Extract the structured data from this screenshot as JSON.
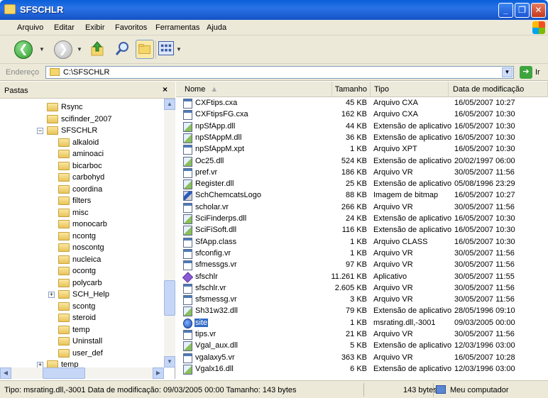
{
  "window": {
    "title": "SFSCHLR"
  },
  "menu": [
    "Arquivo",
    "Editar",
    "Exibir",
    "Favoritos",
    "Ferramentas",
    "Ajuda"
  ],
  "address": {
    "label": "Endereço",
    "value": "C:\\SFSCHLR",
    "go_label": "Ir"
  },
  "folders_pane": {
    "title": "Pastas",
    "close": "×",
    "items": [
      {
        "label": "Rsync",
        "level": 1
      },
      {
        "label": "scifinder_2007",
        "level": 1
      },
      {
        "label": "SFSCHLR",
        "level": 1,
        "expanded": true
      },
      {
        "label": "alkaloid",
        "level": 2
      },
      {
        "label": "aminoaci",
        "level": 2
      },
      {
        "label": "bicarboc",
        "level": 2
      },
      {
        "label": "carbohyd",
        "level": 2
      },
      {
        "label": "coordina",
        "level": 2
      },
      {
        "label": "filters",
        "level": 2
      },
      {
        "label": "misc",
        "level": 2
      },
      {
        "label": "monocarb",
        "level": 2
      },
      {
        "label": "ncontg",
        "level": 2
      },
      {
        "label": "noscontg",
        "level": 2
      },
      {
        "label": "nucleica",
        "level": 2
      },
      {
        "label": "ocontg",
        "level": 2
      },
      {
        "label": "polycarb",
        "level": 2
      },
      {
        "label": "SCH_Help",
        "level": 2,
        "collapsed": true
      },
      {
        "label": "scontg",
        "level": 2
      },
      {
        "label": "steroid",
        "level": 2
      },
      {
        "label": "temp",
        "level": 2
      },
      {
        "label": "Uninstall",
        "level": 2
      },
      {
        "label": "user_def",
        "level": 2
      },
      {
        "label": "temp",
        "level": 1,
        "collapsed": true
      }
    ]
  },
  "columns": {
    "name": "Nome",
    "size": "Tamanho",
    "type": "Tipo",
    "date": "Data de modificação"
  },
  "files": [
    {
      "name": "CXFtips.cxa",
      "size": "45 KB",
      "type": "Arquivo CXA",
      "date": "16/05/2007 10:27",
      "icon": "doc"
    },
    {
      "name": "CXFtipsFG.cxa",
      "size": "162 KB",
      "type": "Arquivo CXA",
      "date": "16/05/2007 10:30",
      "icon": "doc"
    },
    {
      "name": "npSfApp.dll",
      "size": "44 KB",
      "type": "Extensão de aplicativo",
      "date": "16/05/2007 10:30",
      "icon": "dll"
    },
    {
      "name": "npSfAppM.dll",
      "size": "36 KB",
      "type": "Extensão de aplicativo",
      "date": "16/05/2007 10:30",
      "icon": "dll"
    },
    {
      "name": "npSfAppM.xpt",
      "size": "1 KB",
      "type": "Arquivo XPT",
      "date": "16/05/2007 10:30",
      "icon": "doc"
    },
    {
      "name": "Oc25.dll",
      "size": "524 KB",
      "type": "Extensão de aplicativo",
      "date": "20/02/1997 06:00",
      "icon": "dll"
    },
    {
      "name": "pref.vr",
      "size": "186 KB",
      "type": "Arquivo VR",
      "date": "30/05/2007 11:56",
      "icon": "doc"
    },
    {
      "name": "Register.dll",
      "size": "25 KB",
      "type": "Extensão de aplicativo",
      "date": "05/08/1996 23:29",
      "icon": "dll"
    },
    {
      "name": "SchChemcatsLogo",
      "size": "88 KB",
      "type": "Imagem de bitmap",
      "date": "16/05/2007 10:27",
      "icon": "bmp"
    },
    {
      "name": "scholar.vr",
      "size": "266 KB",
      "type": "Arquivo VR",
      "date": "30/05/2007 11:56",
      "icon": "doc"
    },
    {
      "name": "SciFinderps.dll",
      "size": "24 KB",
      "type": "Extensão de aplicativo",
      "date": "16/05/2007 10:30",
      "icon": "dll"
    },
    {
      "name": "SciFiSoft.dll",
      "size": "116 KB",
      "type": "Extensão de aplicativo",
      "date": "16/05/2007 10:30",
      "icon": "dll"
    },
    {
      "name": "SfApp.class",
      "size": "1 KB",
      "type": "Arquivo CLASS",
      "date": "16/05/2007 10:30",
      "icon": "doc"
    },
    {
      "name": "sfconfig.vr",
      "size": "1 KB",
      "type": "Arquivo VR",
      "date": "30/05/2007 11:56",
      "icon": "doc"
    },
    {
      "name": "sfmessgs.vr",
      "size": "97 KB",
      "type": "Arquivo VR",
      "date": "30/05/2007 11:56",
      "icon": "doc"
    },
    {
      "name": "sfschlr",
      "size": "11.261 KB",
      "type": "Aplicativo",
      "date": "30/05/2007 11:55",
      "icon": "app"
    },
    {
      "name": "sfschlr.vr",
      "size": "2.605 KB",
      "type": "Arquivo VR",
      "date": "30/05/2007 11:56",
      "icon": "doc"
    },
    {
      "name": "sfsmessg.vr",
      "size": "3 KB",
      "type": "Arquivo VR",
      "date": "30/05/2007 11:56",
      "icon": "doc"
    },
    {
      "name": "Sh31w32.dll",
      "size": "79 KB",
      "type": "Extensão de aplicativo",
      "date": "28/05/1996 09:10",
      "icon": "dll"
    },
    {
      "name": "site",
      "size": "1 KB",
      "type": "msrating.dll,-3001",
      "date": "09/03/2005 00:00",
      "icon": "url",
      "selected": true
    },
    {
      "name": "tips.vr",
      "size": "21 KB",
      "type": "Arquivo VR",
      "date": "30/05/2007 11:56",
      "icon": "doc"
    },
    {
      "name": "Vgal_aux.dll",
      "size": "5 KB",
      "type": "Extensão de aplicativo",
      "date": "12/03/1996 03:00",
      "icon": "dll"
    },
    {
      "name": "vgalaxy5.vr",
      "size": "363 KB",
      "type": "Arquivo VR",
      "date": "16/05/2007 10:28",
      "icon": "doc"
    },
    {
      "name": "Vgalx16.dll",
      "size": "6 KB",
      "type": "Extensão de aplicativo",
      "date": "12/03/1996 03:00",
      "icon": "dll"
    }
  ],
  "status": {
    "text": "Tipo: msrating.dll,-3001 Data de modificação: 09/03/2005 00:00 Tamanho: 143 bytes",
    "size": "143 bytes",
    "location": "Meu computador"
  }
}
